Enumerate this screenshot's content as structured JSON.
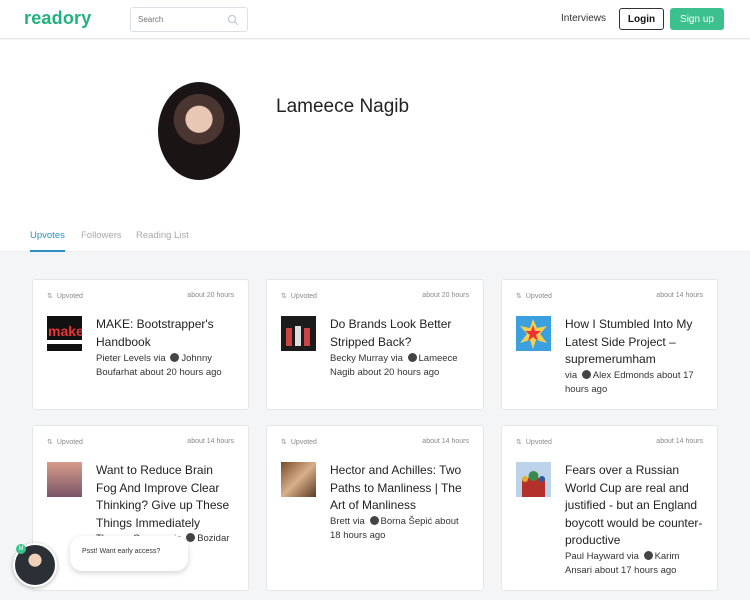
{
  "header": {
    "logo": "readory",
    "search_placeholder": "Search",
    "interviews_label": "Interviews",
    "login_label": "Login",
    "signup_label": "Sign up",
    "brand_color": "#21b07e"
  },
  "profile": {
    "name": "Lameece Nagib"
  },
  "tabs": [
    {
      "label": "Upvotes",
      "active": true
    },
    {
      "label": "Followers",
      "active": false
    },
    {
      "label": "Reading List",
      "active": false
    }
  ],
  "cards": [
    {
      "meta": "Upvoted",
      "time": "about 20 hours",
      "title": "MAKE: Bootstrapper's Handbook",
      "author_pre": "Pieter Levels via",
      "author_post": "Johnny Boufarhat about 20 hours ago",
      "thumb_icon": "make-book-cover"
    },
    {
      "meta": "Upvoted",
      "time": "about 20 hours",
      "title": "Do Brands Look Better Stripped Back?",
      "author_pre": "Becky Murray via",
      "author_post": "Lameece Nagib about 20 hours ago",
      "thumb_icon": "brand-bottles-image"
    },
    {
      "meta": "Upvoted",
      "time": "about 14 hours",
      "title": "How I Stumbled Into My Latest Side Project – supremerumham",
      "author_pre": "via",
      "author_post": "Alex Edmonds about 17 hours ago",
      "thumb_icon": "comic-pow-image"
    },
    {
      "meta": "Upvoted",
      "time": "about 14 hours",
      "title": "Want to Reduce Brain Fog And Improve Clear Thinking? Give up These Things Immediately",
      "author_pre": "Thomas Oppong via",
      "author_post": "Bozidar hours ago",
      "thumb_icon": "sunset-silhouette-image"
    },
    {
      "meta": "Upvoted",
      "time": "about 14 hours",
      "title": "Hector and Achilles: Two Paths to Manliness | The Art of Manliness",
      "author_pre": "Brett via",
      "author_post": "Borna Šepić about 18 hours ago",
      "thumb_icon": "classical-painting-image"
    },
    {
      "meta": "Upvoted",
      "time": "about 14 hours",
      "title": "Fears over a Russian World Cup are real and justified - but an England boycott would be counter-productive",
      "author_pre": "Paul Hayward via",
      "author_post": "Karim Ansari about 17 hours ago",
      "thumb_icon": "moscow-cathedral-image"
    }
  ],
  "chat": {
    "badge": "M",
    "bubble_text": "Psst! Want early access?"
  }
}
